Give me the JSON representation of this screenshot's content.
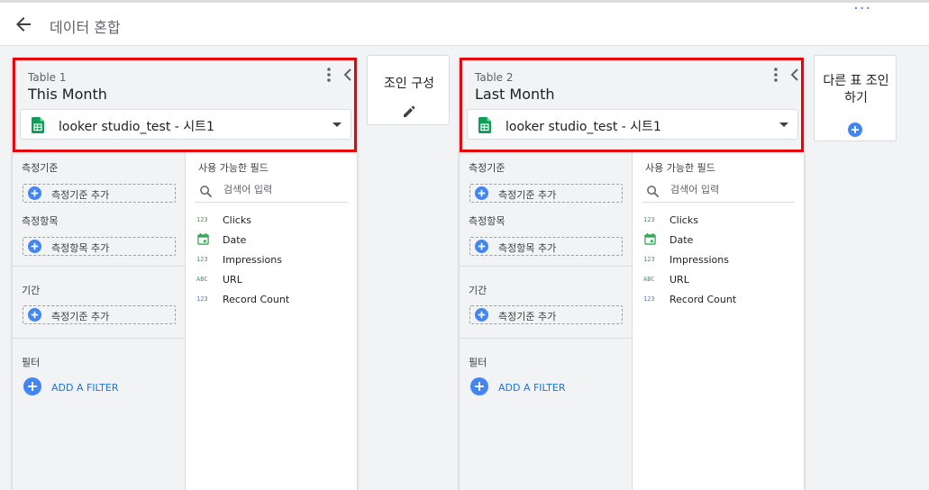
{
  "header": {
    "title": "데이터 혼합",
    "more": "···"
  },
  "tables": [
    {
      "label": "Table 1",
      "name": "This Month",
      "source": "looker studio_test - 시트1",
      "dimension_label": "측정기준",
      "add_dimension": "측정기준 추가",
      "metric_label": "측정항목",
      "add_metric": "측정항목 추가",
      "date_label": "기간",
      "add_date": "측정기준 추가",
      "filter_label": "필터",
      "add_filter": "ADD A FILTER",
      "available_title": "사용 가능한 필드",
      "search_placeholder": "검색어 입력",
      "fields": [
        {
          "type": "123",
          "type_icon": "number-icon",
          "name": "Clicks"
        },
        {
          "type": "",
          "type_icon": "calendar-icon",
          "name": "Date"
        },
        {
          "type": "123",
          "type_icon": "number-icon",
          "name": "Impressions"
        },
        {
          "type": "ABC",
          "type_icon": "text-icon",
          "name": "URL"
        },
        {
          "type": "123",
          "type_icon": "number-icon",
          "name": "Record Count"
        }
      ]
    },
    {
      "label": "Table 2",
      "name": "Last Month",
      "source": "looker studio_test - 시트1",
      "dimension_label": "측정기준",
      "add_dimension": "측정기준 추가",
      "metric_label": "측정항목",
      "add_metric": "측정항목 추가",
      "date_label": "기간",
      "add_date": "측정기준 추가",
      "filter_label": "필터",
      "add_filter": "ADD A FILTER",
      "available_title": "사용 가능한 필드",
      "search_placeholder": "검색어 입력",
      "fields": [
        {
          "type": "123",
          "type_icon": "number-icon",
          "name": "Clicks"
        },
        {
          "type": "",
          "type_icon": "calendar-icon",
          "name": "Date"
        },
        {
          "type": "123",
          "type_icon": "number-icon",
          "name": "Impressions"
        },
        {
          "type": "ABC",
          "type_icon": "text-icon",
          "name": "URL"
        },
        {
          "type": "123",
          "type_icon": "number-icon",
          "name": "Record Count"
        }
      ]
    }
  ],
  "join": {
    "label": "조인 구성"
  },
  "other_join": {
    "label_line1": "다른 표 조인",
    "label_line2": "하기"
  },
  "colors": {
    "accent": "#4285f4",
    "highlight_border": "#e8000a",
    "sheets_green": "#0f9d58"
  }
}
